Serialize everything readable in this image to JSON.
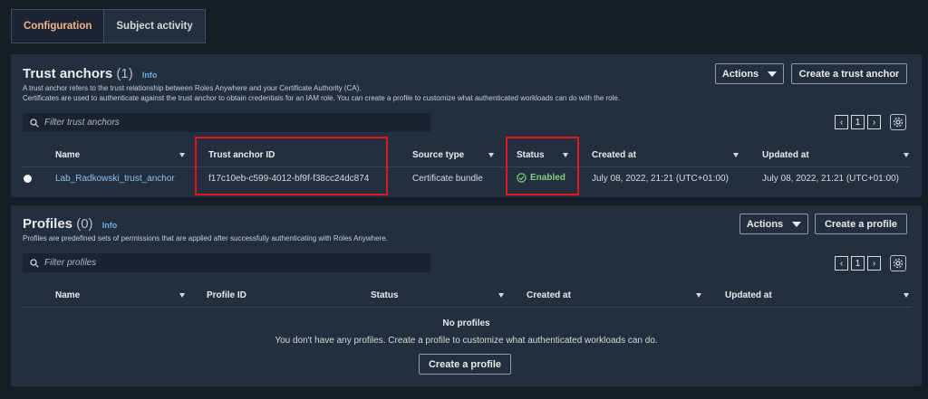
{
  "tabs": [
    {
      "label": "Configuration",
      "active": true
    },
    {
      "label": "Subject activity",
      "active": false
    }
  ],
  "trust_anchors": {
    "title": "Trust anchors",
    "count": "(1)",
    "info": "Info",
    "desc_line1": "A trust anchor refers to the trust relationship between Roles Anywhere and your Certificate Authority (CA).",
    "desc_line2": "Certificates are used to authenticate against the trust anchor to obtain credentials for an IAM role. You can create a profile to customize what authenticated workloads can do with the role.",
    "actions_label": "Actions",
    "create_label": "Create a trust anchor",
    "filter_placeholder": "Filter trust anchors",
    "page": "1",
    "columns": [
      "Name",
      "Trust anchor ID",
      "Source type",
      "Status",
      "Created at",
      "Updated at"
    ],
    "rows": [
      {
        "name": "Lab_Radkowski_trust_anchor",
        "id": "f17c10eb-c599-4012-bf9f-f38cc24dc874",
        "source_type": "Certificate bundle",
        "status": "Enabled",
        "created_at": "July 08, 2022, 21:21 (UTC+01:00)",
        "updated_at": "July 08, 2022, 21:21 (UTC+01:00)"
      }
    ]
  },
  "profiles": {
    "title": "Profiles",
    "count": "(0)",
    "info": "Info",
    "desc": "Profiles are predefined sets of permissions that are applied after successfully authenticating with Roles Anywhere.",
    "actions_label": "Actions",
    "create_label": "Create a profile",
    "filter_placeholder": "Filter profiles",
    "page": "1",
    "columns": [
      "Name",
      "Profile ID",
      "Status",
      "Created at",
      "Updated at"
    ],
    "empty_title": "No profiles",
    "empty_text": "You don't have any profiles. Create a profile to customize what authenticated workloads can do.",
    "empty_button": "Create a profile"
  },
  "colors": {
    "background": "#161d26",
    "panel": "#232f3e",
    "active_tab": "#f2b48a",
    "link": "#89c2f0",
    "success": "#7fd082",
    "highlight": "#e0191b"
  },
  "icons": [
    "search-icon",
    "chevron-left-icon",
    "chevron-right-icon",
    "gear-icon",
    "check-circle-icon",
    "caret-down-icon",
    "sort-triangle-icon"
  ]
}
